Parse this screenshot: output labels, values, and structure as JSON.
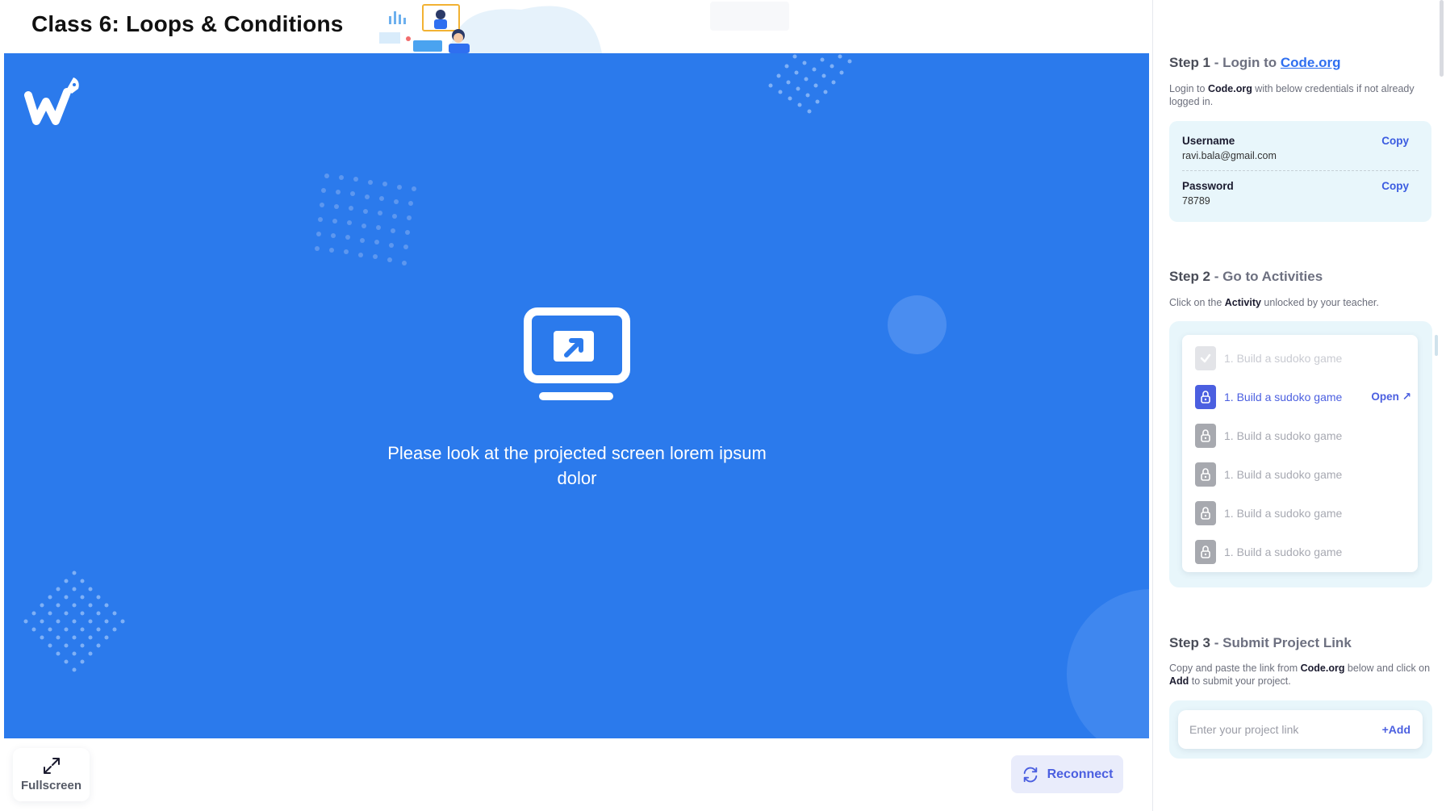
{
  "header": {
    "class_title": "Class 6: Loops & Conditions"
  },
  "stage": {
    "message": "Please look at the projected screen lorem ipsum dolor",
    "icon": "screen-share-icon",
    "background_color": "#2b7aec"
  },
  "controls": {
    "fullscreen_label": "Fullscreen",
    "reconnect_label": "Reconnect"
  },
  "step1": {
    "number": "Step 1",
    "title_prefix": " - Login to ",
    "title_link": "Code.org",
    "desc_pre": "Login to ",
    "desc_bold": "Code.org",
    "desc_post": " with below credentials if not already logged in.",
    "username_label": "Username",
    "username_value": "ravi.bala@gmail.com",
    "password_label": "Password",
    "password_value": "78789",
    "copy_label": "Copy"
  },
  "step2": {
    "number": "Step 2",
    "title": " - Go to Activities",
    "desc_pre": "Click on the ",
    "desc_bold": "Activity",
    "desc_post": " unlocked by your teacher.",
    "activities": [
      {
        "label": "1. Build a sudoko game",
        "state": "done"
      },
      {
        "label": "1. Build a sudoko game",
        "state": "active",
        "action": "Open ↗"
      },
      {
        "label": "1. Build a sudoko game",
        "state": "locked"
      },
      {
        "label": "1. Build a sudoko game",
        "state": "locked"
      },
      {
        "label": "1. Build a sudoko game",
        "state": "locked"
      },
      {
        "label": "1. Build a sudoko game",
        "state": "locked"
      }
    ]
  },
  "step3": {
    "number": "Step 3",
    "title": " - Submit Project Link",
    "desc_pre": "Copy and paste the link from ",
    "desc_bold1": "Code.org",
    "desc_mid": " below and click on ",
    "desc_bold2": "Add",
    "desc_post": " to submit your project.",
    "input_placeholder": "Enter your project link",
    "add_label": "+Add"
  },
  "colors": {
    "accent": "#4b5fe0",
    "link": "#2f6ff0",
    "card_bg": "#e8f6fb"
  }
}
